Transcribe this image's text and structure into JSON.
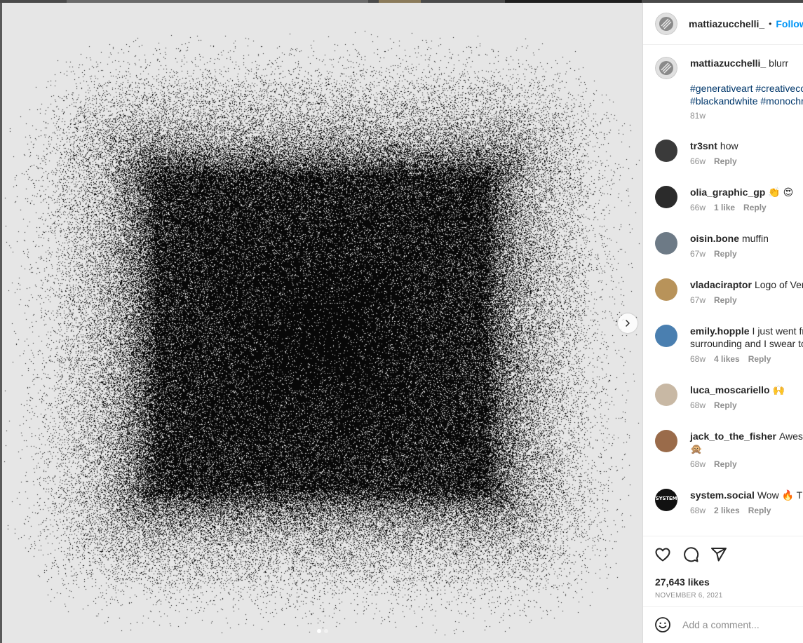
{
  "post": {
    "author": "mattiazucchelli_",
    "separator": "•",
    "follow_label": "Follow",
    "caption_text": "blurr",
    "hashtags_line1": "#generativeart #creativecoding",
    "hashtags_line2": "#blackandwhite #monochrome",
    "caption_time": "81w",
    "likes": "27,643 likes",
    "date": "NOVEMBER 6, 2021",
    "add_comment_placeholder": "Add a comment..."
  },
  "comments": [
    {
      "user": "tr3snt",
      "text": "how",
      "line2": "",
      "time": "66w",
      "likes": "",
      "reply": "Reply",
      "avatar_color": "#3a3a3a"
    },
    {
      "user": "olia_graphic_gp",
      "text": "👏 😍",
      "line2": "",
      "time": "66w",
      "likes": "1 like",
      "reply": "Reply",
      "avatar_color": "#2b2b2b"
    },
    {
      "user": "oisin.bone",
      "text": "muffin",
      "line2": "",
      "time": "67w",
      "likes": "",
      "reply": "Reply",
      "avatar_color": "#6d7a86"
    },
    {
      "user": "vladaciraptor",
      "text": "Logo of Versace",
      "line2": "",
      "time": "67w",
      "likes": "",
      "reply": "Reply",
      "avatar_color": "#b8935a"
    },
    {
      "user": "emily.hopple",
      "text": "I just went from",
      "line2": "surrounding and I swear to god",
      "time": "68w",
      "likes": "4 likes",
      "reply": "Reply",
      "avatar_color": "#4a7fb0"
    },
    {
      "user": "luca_moscariello",
      "text": "🙌",
      "line2": "",
      "time": "68w",
      "likes": "",
      "reply": "Reply",
      "avatar_color": "#c8b8a4"
    },
    {
      "user": "jack_to_the_fisher",
      "text": "Awesome",
      "line2": "🙊",
      "time": "68w",
      "likes": "",
      "reply": "Reply",
      "avatar_color": "#9a6b4a"
    },
    {
      "user": "system.social",
      "text": "Wow 🔥 This",
      "line2": "",
      "time": "68w",
      "likes": "2 likes",
      "reply": "Reply",
      "avatar_color": "#111111",
      "avatar_text": "SYSTEM"
    }
  ],
  "colors": {
    "accent": "#0095f6",
    "hashtag": "#00376b",
    "muted": "#8e8e8e",
    "media_bg": "#e6e6e6"
  },
  "icons": {
    "like": "heart-icon",
    "comment": "comment-icon",
    "share": "send-icon",
    "emoji": "emoji-icon",
    "next": "chevron-right-icon"
  }
}
